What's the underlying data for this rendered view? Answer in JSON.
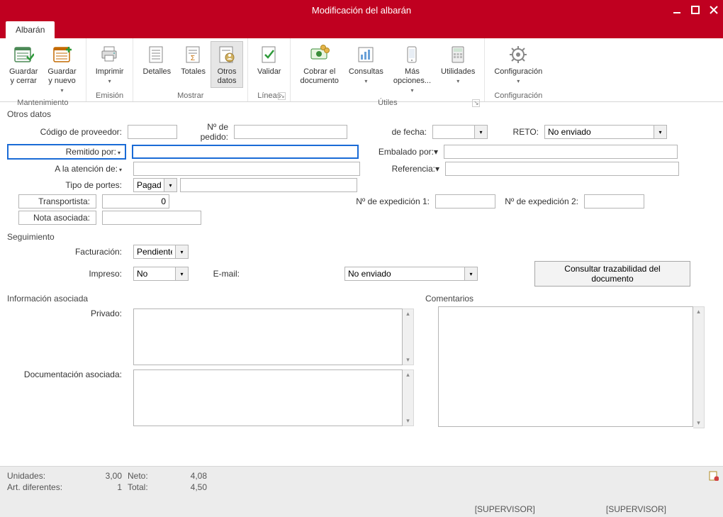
{
  "window": {
    "title": "Modificación del albarán"
  },
  "tab": {
    "label": "Albarán"
  },
  "ribbon": {
    "groups": {
      "mantenimiento": {
        "label": "Mantenimiento",
        "save_close": "Guardar\ny cerrar",
        "save_new": "Guardar\ny nuevo"
      },
      "emision": {
        "label": "Emisión",
        "imprimir": "Imprimir"
      },
      "mostrar": {
        "label": "Mostrar",
        "detalles": "Detalles",
        "totales": "Totales",
        "otros_datos": "Otros\ndatos"
      },
      "lineas": {
        "label": "Líneas",
        "validar": "Validar"
      },
      "utiles": {
        "label": "Útiles",
        "cobrar": "Cobrar el\ndocumento",
        "consultas": "Consultas",
        "mas": "Más\nopciones...",
        "utilidades": "Utilidades"
      },
      "config": {
        "label": "Configuración",
        "config": "Configuración"
      }
    }
  },
  "form": {
    "sections": {
      "otros": "Otros datos",
      "seguimiento": "Seguimiento",
      "info": "Información asociada",
      "comentarios": "Comentarios"
    },
    "labels": {
      "cod_prov": "Código de proveedor:",
      "n_pedido": "Nº de pedido:",
      "de_fecha": "de fecha:",
      "reto": "RETO:",
      "remitido_por": "Remitido por:",
      "embalado_por": "Embalado por:",
      "atencion": "A la atención de:",
      "referencia": "Referencia:",
      "tipo_portes": "Tipo de portes:",
      "transportista": "Transportista:",
      "nota": "Nota asociada:",
      "n_exp1": "Nº de expedición 1:",
      "n_exp2": "Nº de expedición 2:",
      "facturacion": "Facturación:",
      "impreso": "Impreso:",
      "email": "E-mail:",
      "privado": "Privado:",
      "doc_asociada": "Documentación asociada:"
    },
    "values": {
      "cod_prov": "",
      "n_pedido": "",
      "de_fecha": "",
      "reto": "No enviado",
      "remitido_por": "",
      "embalado_por": "",
      "atencion": "",
      "referencia": "",
      "tipo_portes": "Pagados",
      "tipo_portes_extra": "",
      "transportista": "0",
      "nota": "",
      "n_exp1": "",
      "n_exp2": "",
      "facturacion": "Pendiente",
      "impreso": "No",
      "email": "No enviado",
      "privado": "",
      "doc_asociada": "",
      "comentarios": ""
    },
    "buttons": {
      "trazabilidad": "Consultar trazabilidad del documento"
    }
  },
  "status": {
    "labels": {
      "unidades": "Unidades:",
      "art_dif": "Art. diferentes:",
      "neto": "Neto:",
      "total": "Total:"
    },
    "values": {
      "unidades": "3,00",
      "art_dif": "1",
      "neto": "4,08",
      "total": "4,50"
    },
    "user1": "[SUPERVISOR]",
    "user2": "[SUPERVISOR]"
  }
}
